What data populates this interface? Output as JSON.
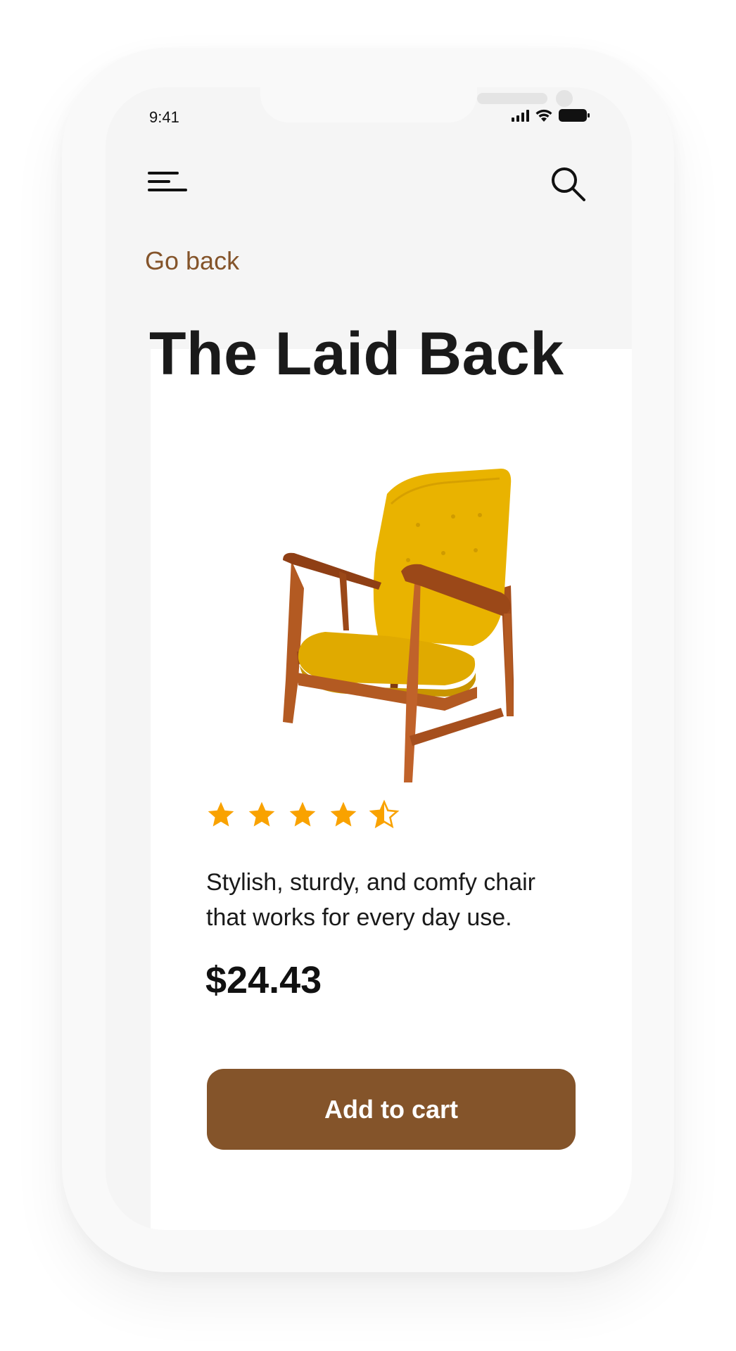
{
  "status_bar": {
    "time": "9:41",
    "signal_icon": "cellular-signal-icon",
    "wifi_icon": "wifi-icon",
    "battery_icon": "battery-icon"
  },
  "header": {
    "menu_icon": "hamburger-menu-icon",
    "search_icon": "search-icon"
  },
  "nav": {
    "back_label": "Go back"
  },
  "product": {
    "title": "The Laid Back",
    "image_icon": "yellow-armchair-image",
    "rating": 4.5,
    "rating_max": 5,
    "description": "Stylish, sturdy, and comfy chair that works for every day use.",
    "price": "$24.43"
  },
  "actions": {
    "add_to_cart_label": "Add to cart"
  },
  "colors": {
    "accent": "#84542a",
    "star": "#f9a200",
    "screen_bg": "#f5f5f5",
    "card_bg": "#ffffff",
    "text": "#1a1a1a"
  }
}
